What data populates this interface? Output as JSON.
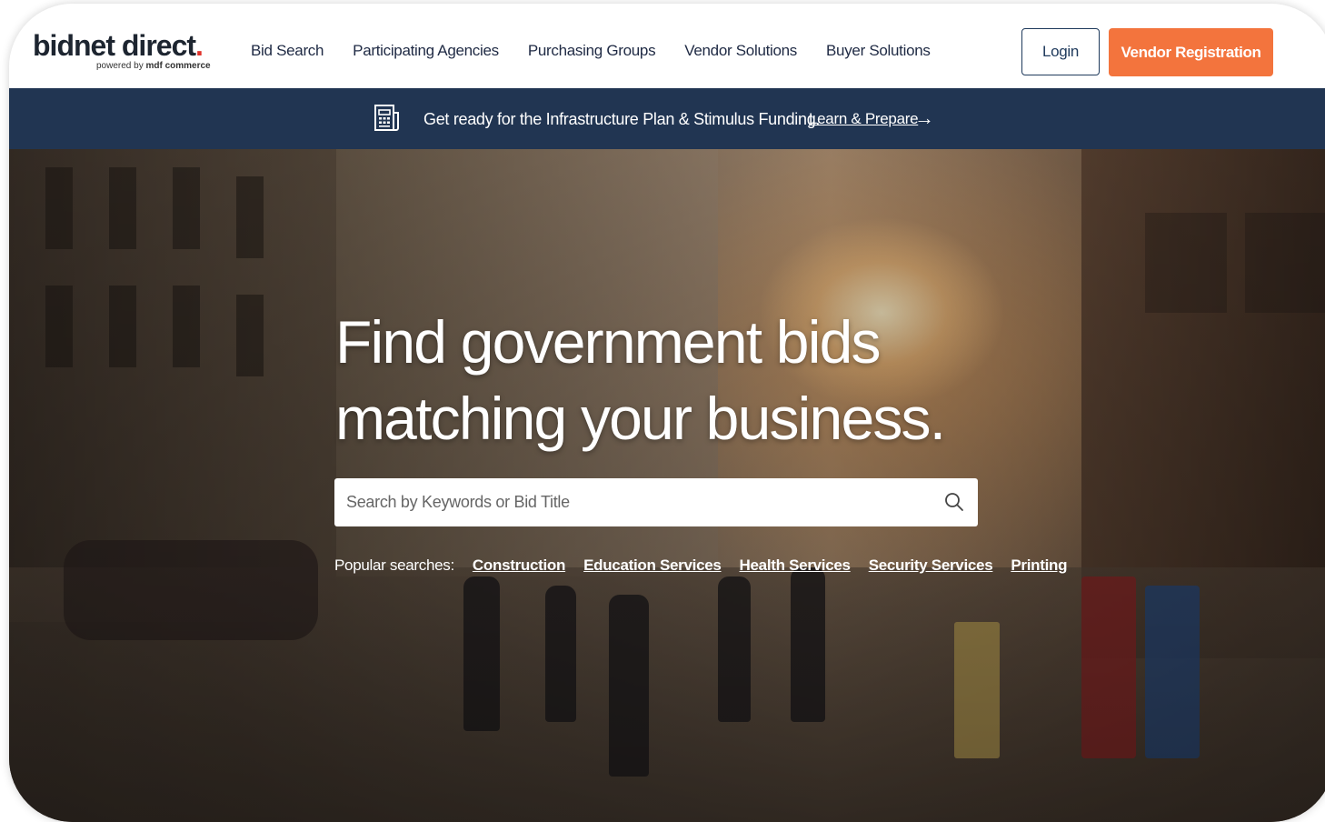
{
  "logo": {
    "name": "bidnet direct",
    "dot": ".",
    "tagline_prefix": "powered by",
    "tagline_brand": "mdf commerce"
  },
  "nav": {
    "items": [
      {
        "label": "Bid Search"
      },
      {
        "label": "Participating Agencies"
      },
      {
        "label": "Purchasing Groups"
      },
      {
        "label": "Vendor Solutions"
      },
      {
        "label": "Buyer Solutions"
      }
    ],
    "login_label": "Login",
    "register_label": "Vendor Registration"
  },
  "banner": {
    "icon": "newspaper-icon",
    "text": "Get ready for the Infrastructure Plan & Stimulus Funding.",
    "link_label": "Learn & Prepare",
    "arrow": "→"
  },
  "hero": {
    "title_line1": "Find government bids",
    "title_line2": "matching your business.",
    "search_placeholder": "Search by Keywords or Bid Title",
    "search_icon": "search-icon",
    "popular_label": "Popular searches:",
    "popular_searches": [
      "Construction",
      "Education Services",
      "Health Services",
      "Security Services",
      "Printing"
    ]
  },
  "colors": {
    "brand_orange": "#f3743d",
    "banner_navy": "#213552",
    "logo_dot_red": "#e0332b",
    "nav_text": "#1f2a44"
  }
}
